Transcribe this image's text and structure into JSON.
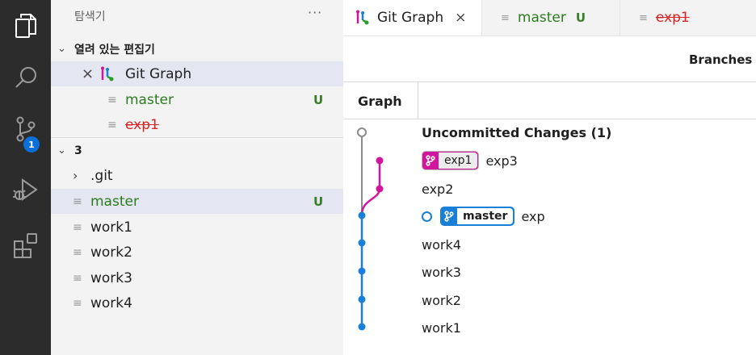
{
  "activity_bar": {
    "icons": [
      "explorer-icon",
      "search-icon",
      "source-control-icon",
      "run-debug-icon",
      "extensions-icon"
    ],
    "scm_badge": "1"
  },
  "sidebar": {
    "title": "탐색기",
    "more": "···",
    "open_editors": {
      "section": "열려 있는 편집기",
      "items": [
        {
          "label": "Git Graph",
          "status": ""
        },
        {
          "label": "master",
          "status": "U"
        },
        {
          "label": "exp1",
          "status": ""
        }
      ]
    },
    "folder": {
      "section": "3",
      "items": [
        {
          "label": ".git",
          "status": ""
        },
        {
          "label": "master",
          "status": "U"
        },
        {
          "label": "work1",
          "status": ""
        },
        {
          "label": "work2",
          "status": ""
        },
        {
          "label": "work3",
          "status": ""
        },
        {
          "label": "work4",
          "status": ""
        }
      ]
    }
  },
  "tabs": [
    {
      "label": "Git Graph",
      "close": "×"
    },
    {
      "label": "master",
      "status": "U"
    },
    {
      "label": "exp1"
    }
  ],
  "gitgraph": {
    "toolbar_label": "Branches",
    "column_graph": "Graph",
    "commits": [
      {
        "message": "Uncommitted Changes (1)",
        "refs": []
      },
      {
        "message": "exp3",
        "refs": [
          {
            "name": "exp1",
            "color": "#d1159c"
          }
        ]
      },
      {
        "message": "exp2",
        "refs": []
      },
      {
        "message": "exp",
        "refs": [
          {
            "name": "master",
            "color": "#1a7fd6"
          }
        ],
        "head": true
      },
      {
        "message": "work4",
        "refs": []
      },
      {
        "message": "work3",
        "refs": []
      },
      {
        "message": "work2",
        "refs": []
      },
      {
        "message": "work1",
        "refs": []
      }
    ]
  },
  "colors": {
    "activity_bar": "#2c2c2c",
    "sidebar": "#f3f3f3",
    "selection": "#e4e6f1",
    "branch_master": "#1a7fd6",
    "branch_exp1": "#d1159c",
    "uncommitted": "#8a8a8a",
    "untracked_green": "#2a7d1e",
    "deleted_red": "#d62424"
  }
}
